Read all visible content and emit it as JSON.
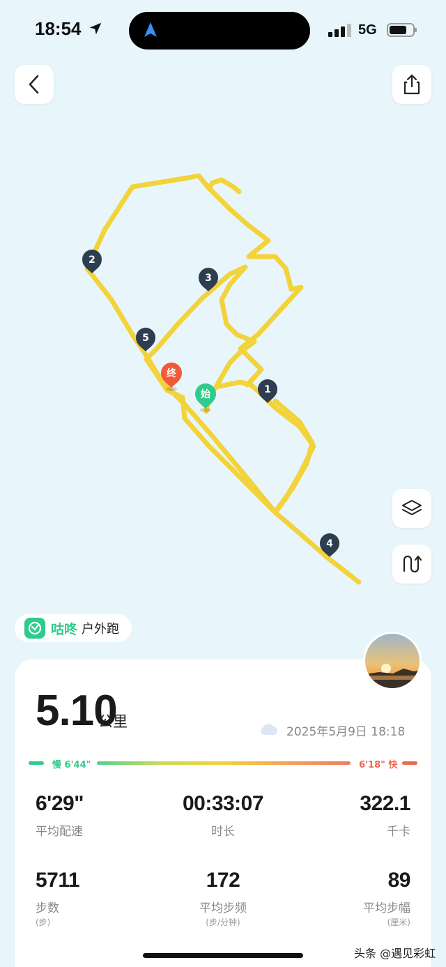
{
  "status_bar": {
    "time": "18:54",
    "network": "5G",
    "icons": [
      "location-arrow-icon",
      "navigation-icon",
      "signal-icon",
      "battery-icon"
    ]
  },
  "header": {
    "icons": [
      "back-icon",
      "share-icon"
    ]
  },
  "map": {
    "route_color": "#f3d33b",
    "start_label": "始",
    "end_label": "终",
    "km_markers": [
      "1",
      "2",
      "3",
      "4",
      "5"
    ],
    "icons": [
      "layers-icon",
      "route-toggle-icon"
    ]
  },
  "brand": {
    "name": "咕咚",
    "mode": "户外跑",
    "icon": "gudong-logo-icon"
  },
  "summary": {
    "distance": "5.10",
    "distance_unit": "公里",
    "datetime": "2025年5月9日 18:18",
    "weather_icon": "cloud-icon",
    "pace_slow": "慢 6'44\"",
    "pace_fast": "6'18\" 快"
  },
  "stats": {
    "avg_pace": {
      "value": "6'29\"",
      "label": "平均配速"
    },
    "duration": {
      "value": "00:33:07",
      "label": "时长"
    },
    "calories": {
      "value": "322.1",
      "label": "千卡"
    },
    "steps": {
      "value": "5711",
      "label": "步数",
      "unit": "(步)"
    },
    "cadence": {
      "value": "172",
      "label": "平均步频",
      "unit": "(步/分钟)"
    },
    "stride": {
      "value": "89",
      "label": "平均步幅",
      "unit": "(厘米)"
    }
  },
  "watermark": "头条 @遇见彩虹",
  "colors": {
    "accent_green": "#2ecc8c",
    "accent_red": "#ef6a4c",
    "marker_dark": "#2d3e50",
    "background": "#e8f6fb"
  }
}
